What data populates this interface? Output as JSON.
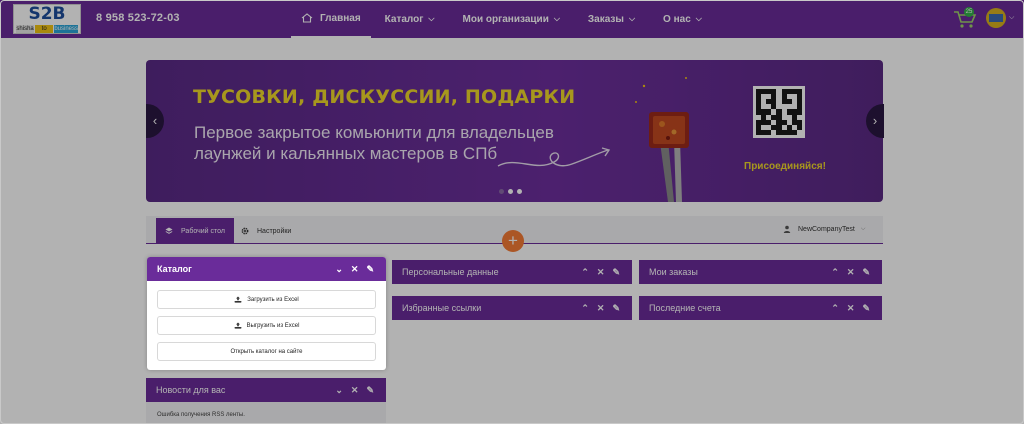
{
  "header": {
    "logo": {
      "top": "S2B",
      "segments": [
        "shisha",
        "to",
        "business"
      ]
    },
    "phone": "8 958 523-72-03",
    "nav": [
      {
        "label": "Главная",
        "icon": "home-icon",
        "active": true
      },
      {
        "label": "Каталог",
        "has_dropdown": true
      },
      {
        "label": "Мои организации",
        "has_dropdown": true
      },
      {
        "label": "Заказы",
        "has_dropdown": true
      },
      {
        "label": "О нас",
        "has_dropdown": true
      }
    ],
    "cart_count": "25"
  },
  "banner": {
    "headline": "ТУСОВКИ, ДИСКУССИИ, ПОДАРКИ",
    "text": "Первое закрытое комьюнити для владельцев лаунжей и кальянных мастеров в СПб",
    "join": "Присоединяйся!",
    "slide_count": 3,
    "active_slide": 1
  },
  "tabs": [
    {
      "label": "Рабочий стол",
      "icon": "layers-icon",
      "active": true
    },
    {
      "label": "Настройки",
      "icon": "gear-icon",
      "active": false
    }
  ],
  "company": {
    "name": "NewCompanyTest"
  },
  "widgets": {
    "catalog": {
      "title": "Каталог",
      "buttons": [
        "Загрузить из Excel",
        "Выгрузить из Excel",
        "Открыть каталог на сайте"
      ]
    },
    "news": {
      "title": "Новости для вас",
      "body": "Ошибка получения RSS ленты."
    },
    "personal": {
      "title": "Персональные данные"
    },
    "favorites": {
      "title": "Избранные ссылки"
    },
    "orders": {
      "title": "Мои заказы"
    },
    "bills": {
      "title": "Последние счета"
    }
  },
  "colors": {
    "brand": "#6a2c9a",
    "accent": "#f0d82a",
    "add_button": "#f57c36"
  }
}
